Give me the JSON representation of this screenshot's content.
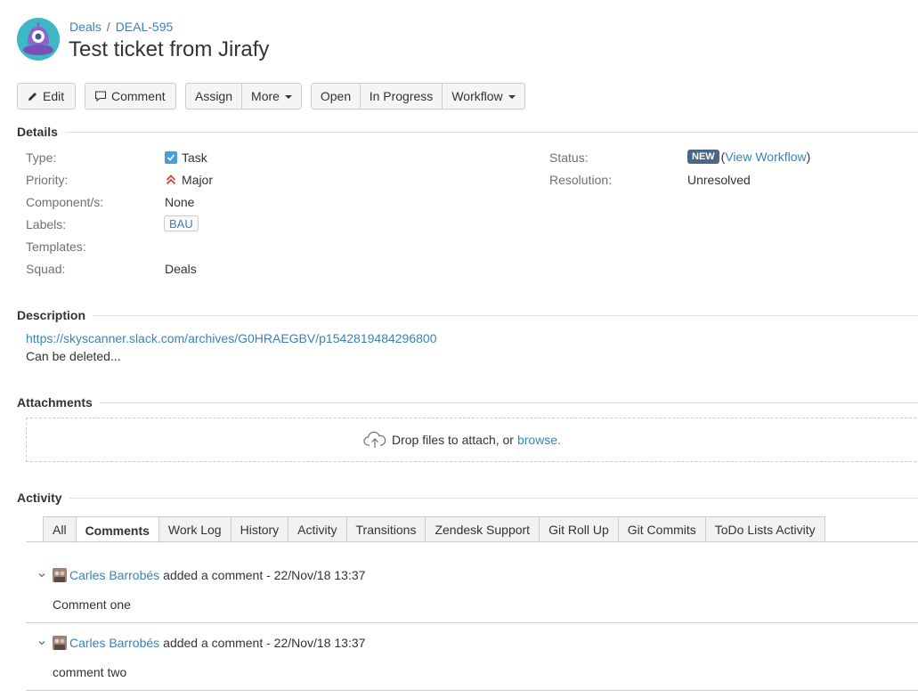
{
  "breadcrumb": {
    "project": "Deals",
    "separator": "/",
    "issue_key": "DEAL-595"
  },
  "issue": {
    "title": "Test ticket from Jirafy"
  },
  "toolbar": {
    "edit": "Edit",
    "comment": "Comment",
    "assign": "Assign",
    "more": "More",
    "open": "Open",
    "in_progress": "In Progress",
    "workflow": "Workflow"
  },
  "details": {
    "heading": "Details",
    "type_label": "Type:",
    "type_value": "Task",
    "priority_label": "Priority:",
    "priority_value": "Major",
    "components_label": "Component/s:",
    "components_value": "None",
    "labels_label": "Labels:",
    "labels_value": "BAU",
    "templates_label": "Templates:",
    "squad_label": "Squad:",
    "squad_value": "Deals",
    "status_label": "Status:",
    "status_value": "NEW",
    "view_workflow": "View Workflow",
    "resolution_label": "Resolution:",
    "resolution_value": "Unresolved"
  },
  "description": {
    "heading": "Description",
    "link": "https://skyscanner.slack.com/archives/G0HRAEGBV/p1542819484296800",
    "text": "Can be deleted..."
  },
  "attachments": {
    "heading": "Attachments",
    "drop_text": "Drop files to attach, or",
    "browse": "browse."
  },
  "activity": {
    "heading": "Activity",
    "tabs": [
      "All",
      "Comments",
      "Work Log",
      "History",
      "Activity",
      "Transitions",
      "Zendesk Support",
      "Git Roll Up",
      "Git Commits",
      "ToDo Lists Activity"
    ],
    "active_tab": "Comments",
    "comments": [
      {
        "author": "Carles Barrobés",
        "action": "added a comment - 22/Nov/18 13:37",
        "body": "Comment one"
      },
      {
        "author": "Carles Barrobés",
        "action": "added a comment - 22/Nov/18 13:37",
        "body": "comment two"
      }
    ]
  },
  "colors": {
    "link": "#3b82b5",
    "status_lozenge": "#4a6785",
    "avatar_bg": "#3fb8c6",
    "priority_major": "#d04437",
    "task_icon": "#4a9fd8"
  },
  "icons": {
    "project_avatar": "alien-avatar-icon",
    "edit": "pencil-icon",
    "comment": "speech-bubble-icon",
    "task": "checkbox-icon",
    "priority": "double-chevron-up-icon",
    "upload": "cloud-upload-icon",
    "collapse": "chevron-down-icon"
  }
}
